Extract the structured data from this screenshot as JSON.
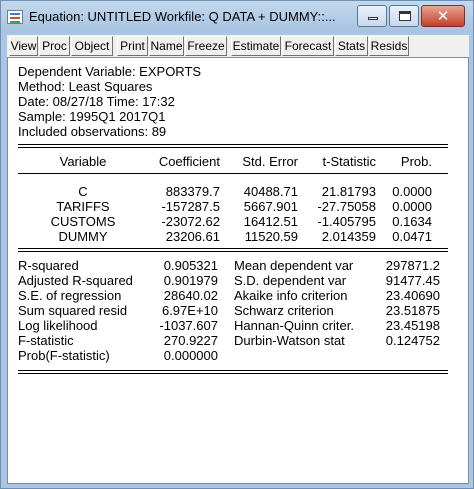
{
  "window": {
    "title": "Equation: UNTITLED   Workfile: Q DATA + DUMMY::...",
    "close_glyph": "✕"
  },
  "toolbar": {
    "buttons": [
      "View",
      "Proc",
      "Object",
      "Print",
      "Name",
      "Freeze",
      "Estimate",
      "Forecast",
      "Stats",
      "Resids"
    ]
  },
  "header": {
    "dependent": "Dependent Variable: EXPORTS",
    "method": "Method: Least Squares",
    "date": "Date: 08/27/18   Time: 17:32",
    "sample": "Sample: 1995Q1 2017Q1",
    "observations": "Included observations: 89"
  },
  "coef_table": {
    "columns": [
      "Variable",
      "Coefficient",
      "Std. Error",
      "t-Statistic",
      "Prob."
    ],
    "rows": [
      [
        "C",
        "883379.7",
        "40488.71",
        "21.81793",
        "0.0000"
      ],
      [
        "TARIFFS",
        "-157287.5",
        "5667.901",
        "-27.75058",
        "0.0000"
      ],
      [
        "CUSTOMS",
        "-23072.62",
        "16412.51",
        "-1.405795",
        "0.1634"
      ],
      [
        "DUMMY",
        "23206.61",
        "11520.59",
        "2.014359",
        "0.0471"
      ]
    ]
  },
  "stats": {
    "left": [
      [
        "R-squared",
        "0.905321"
      ],
      [
        "Adjusted R-squared",
        "0.901979"
      ],
      [
        "S.E. of regression",
        "28640.02"
      ],
      [
        "Sum squared resid",
        "6.97E+10"
      ],
      [
        "Log likelihood",
        "-1037.607"
      ],
      [
        "F-statistic",
        "270.9227"
      ],
      [
        "Prob(F-statistic)",
        "0.000000"
      ]
    ],
    "right": [
      [
        "Mean dependent var",
        "297871.2"
      ],
      [
        "S.D. dependent var",
        "91477.45"
      ],
      [
        "Akaike info criterion",
        "23.40690"
      ],
      [
        "Schwarz criterion",
        "23.51875"
      ],
      [
        "Hannan-Quinn criter.",
        "23.45198"
      ],
      [
        "Durbin-Watson stat",
        "0.124752"
      ]
    ]
  }
}
